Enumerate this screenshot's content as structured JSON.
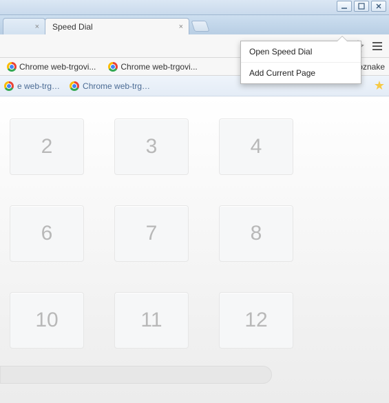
{
  "window": {
    "tabs": [
      {
        "title": "",
        "active": false
      },
      {
        "title": "Speed Dial",
        "active": true
      }
    ]
  },
  "bookmarks_bar": {
    "items": [
      {
        "label": "Chrome web-trgovi..."
      },
      {
        "label": "Chrome web-trgovi..."
      }
    ],
    "overflow_label": "je oznake"
  },
  "subbar": {
    "items": [
      {
        "label": "e web-trg…"
      },
      {
        "label": "Chrome web-trg…"
      }
    ]
  },
  "ext_popup": {
    "items": [
      {
        "label": "Open Speed Dial"
      },
      {
        "label": "Add Current Page"
      }
    ]
  },
  "speed_dial": {
    "tiles": [
      2,
      3,
      4,
      6,
      7,
      8,
      10,
      11,
      12
    ]
  }
}
